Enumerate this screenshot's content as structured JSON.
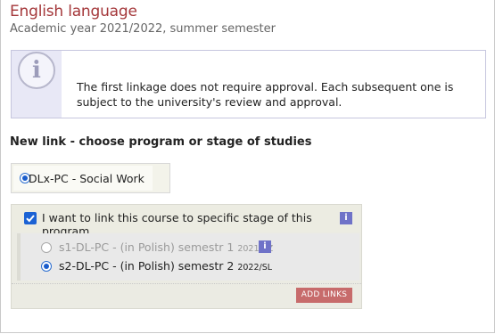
{
  "header": {
    "title": "English language",
    "subtitle": "Academic year 2021/2022, summer semester"
  },
  "notice": {
    "icon": "info-icon",
    "text": "The first linkage does not require approval. Each subsequent one is subject to the university's review and approval."
  },
  "new_link": {
    "heading": "New link - choose program or stage of studies",
    "program": {
      "label": "DLx-PC - Social Work",
      "selected": true
    },
    "stage_option": {
      "label": "I want to link this course to specific stage of this program",
      "checked": true,
      "info_icon": "i"
    },
    "stages": [
      {
        "label": "s1-DL-PC - (in Polish) semestr 1",
        "year": "2021/SZ",
        "selected": false,
        "disabled": true,
        "info_icon": "i"
      },
      {
        "label": "s2-DL-PC - (in Polish) semestr 2",
        "year": "2022/SL",
        "selected": true,
        "disabled": false
      }
    ],
    "add_button": "ADD LINKS"
  },
  "colors": {
    "title": "#a4373a",
    "accent": "#1b62d4",
    "info_badge": "#6f72c8",
    "button": "#c76b6b"
  }
}
